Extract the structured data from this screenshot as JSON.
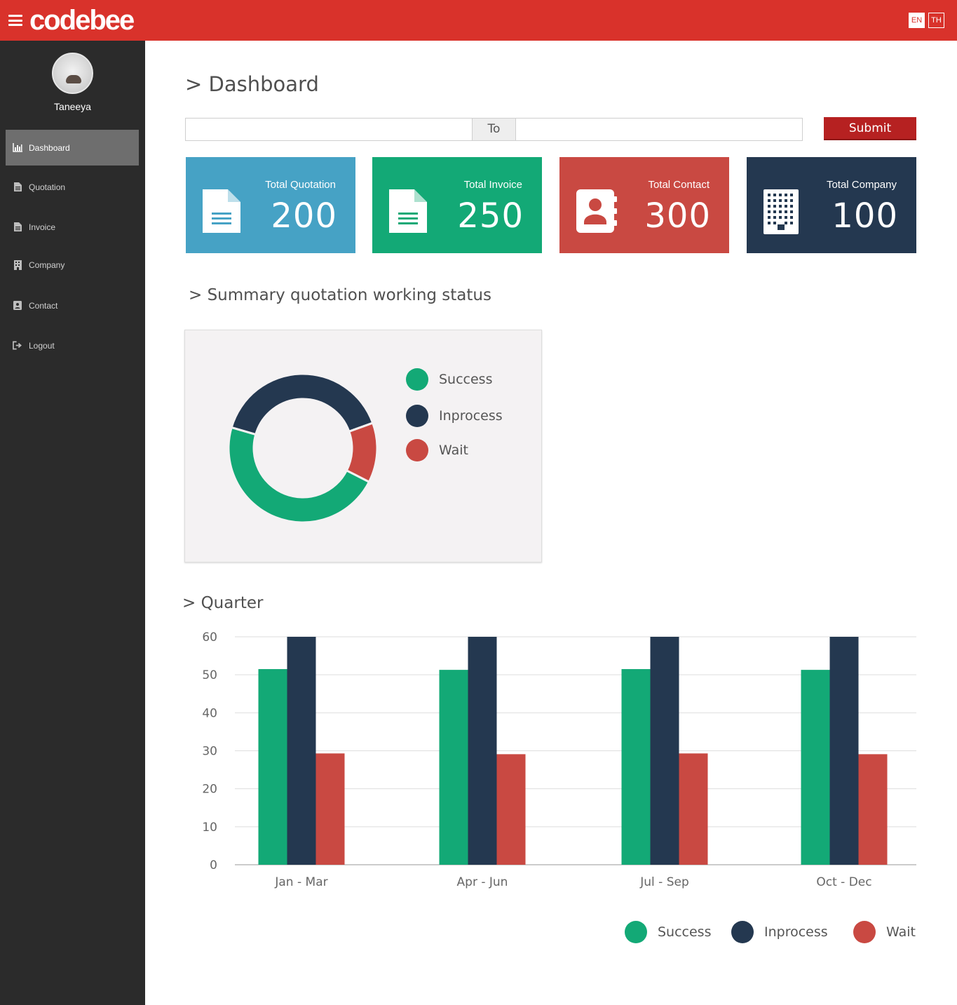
{
  "header": {
    "logo_text": "codebee",
    "languages": [
      "EN",
      "TH"
    ],
    "brand_color": "#d9322b"
  },
  "sidebar": {
    "user_name": "Taneeya",
    "items": [
      {
        "label": "Dashboard",
        "icon": "bar-chart-icon",
        "active": true
      },
      {
        "label": "Quotation",
        "icon": "document-icon",
        "active": false
      },
      {
        "label": "Invoice",
        "icon": "document-icon",
        "active": false
      },
      {
        "label": "Company",
        "icon": "building-icon",
        "active": false
      },
      {
        "label": "Contact",
        "icon": "contact-book-icon",
        "active": false
      },
      {
        "label": "Logout",
        "icon": "logout-icon",
        "active": false
      }
    ]
  },
  "main": {
    "title": "> Dashboard",
    "date_range": {
      "from_value": "",
      "to_label": "To",
      "to_value": "",
      "submit_label": "Submit"
    },
    "cards": [
      {
        "title": "Total Quotation",
        "value": "200",
        "color": "#46a2c5",
        "icon": "document-icon"
      },
      {
        "title": "Total Invoice",
        "value": "250",
        "color": "#13a976",
        "icon": "document-icon"
      },
      {
        "title": "Total Contact",
        "value": "300",
        "color": "#c94942",
        "icon": "contact-book-icon"
      },
      {
        "title": "Total Company",
        "value": "100",
        "color": "#243850",
        "icon": "building-icon"
      }
    ],
    "summary_title": "> Summary quotation working status",
    "quarter_title": "> Quarter"
  },
  "chart_data": [
    {
      "type": "pie",
      "donut": true,
      "categories": [
        "Success",
        "Inprocess",
        "Wait"
      ],
      "values": [
        47,
        40,
        13
      ],
      "colors": [
        "#13a976",
        "#243850",
        "#c94942"
      ],
      "legend": "right"
    },
    {
      "type": "bar",
      "categories": [
        "Jan - Mar",
        "Apr - Jun",
        "Jul - Sep",
        "Oct - Dec"
      ],
      "series": [
        {
          "name": "Success",
          "values": [
            51.5,
            51.3,
            51.5,
            51.3
          ],
          "color": "#13a976"
        },
        {
          "name": "Inprocess",
          "values": [
            60,
            60,
            60,
            60
          ],
          "color": "#243850"
        },
        {
          "name": "Wait",
          "values": [
            29.3,
            29.1,
            29.3,
            29.1
          ],
          "color": "#c94942"
        }
      ],
      "ylim": [
        0,
        60
      ],
      "yticks": [
        0,
        10,
        20,
        30,
        40,
        50,
        60
      ],
      "grid": true,
      "legend": "bottom-right"
    }
  ]
}
